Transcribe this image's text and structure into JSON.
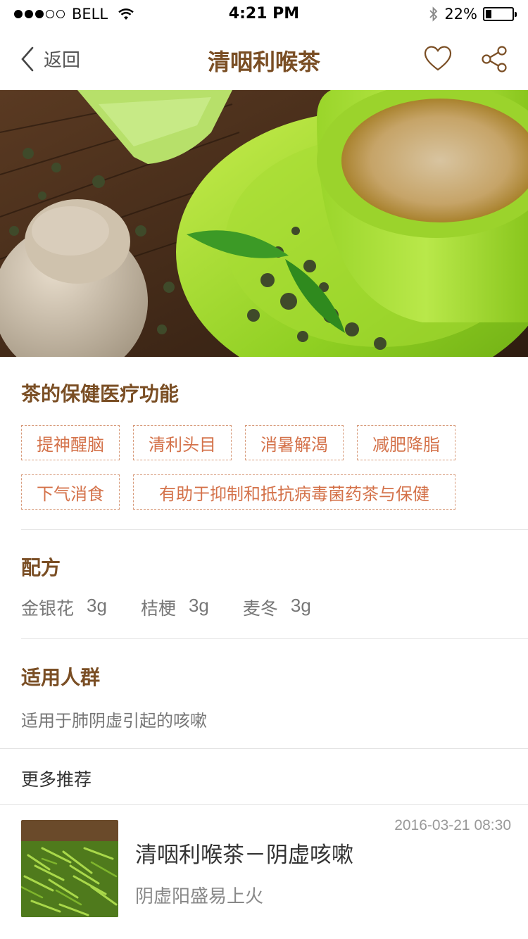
{
  "status_bar": {
    "carrier": "BELL",
    "time": "4:21 PM",
    "battery": "22%",
    "battery_level": 0.22,
    "signal_dots_filled": 3,
    "signal_dots_total": 5
  },
  "nav": {
    "back_label": "返回",
    "title": "清咽利喉茶",
    "icons": [
      "chevron-left-icon",
      "heart-icon",
      "share-icon"
    ]
  },
  "hero": {
    "icon": "tea-cup-photo"
  },
  "health": {
    "title": "茶的保健医疗功能",
    "tags": [
      "提神醒脑",
      "清利头目",
      "消暑解渴",
      "减肥降脂",
      "下气消食",
      "有助于抑制和抵抗病毒菌药茶与保健"
    ]
  },
  "formula": {
    "title": "配方",
    "items": [
      {
        "name": "金银花",
        "amount": "3g"
      },
      {
        "name": "桔梗",
        "amount": "3g"
      },
      {
        "name": "麦冬",
        "amount": "3g"
      }
    ]
  },
  "audience": {
    "title": "适用人群",
    "text": "适用于肺阴虚引起的咳嗽"
  },
  "more": {
    "title": "更多推荐",
    "items": [
      {
        "title": "清咽利喉茶－阴虚咳嗽",
        "subtitle": "阴虚阳盛易上火",
        "date": "2016-03-21 08:30",
        "thumb_icon": "green-tea-leaves-photo"
      }
    ]
  },
  "colors": {
    "accent_brown": "#7a4e24",
    "tag_orange": "#d4724a",
    "tag_border": "#d79a7a"
  }
}
